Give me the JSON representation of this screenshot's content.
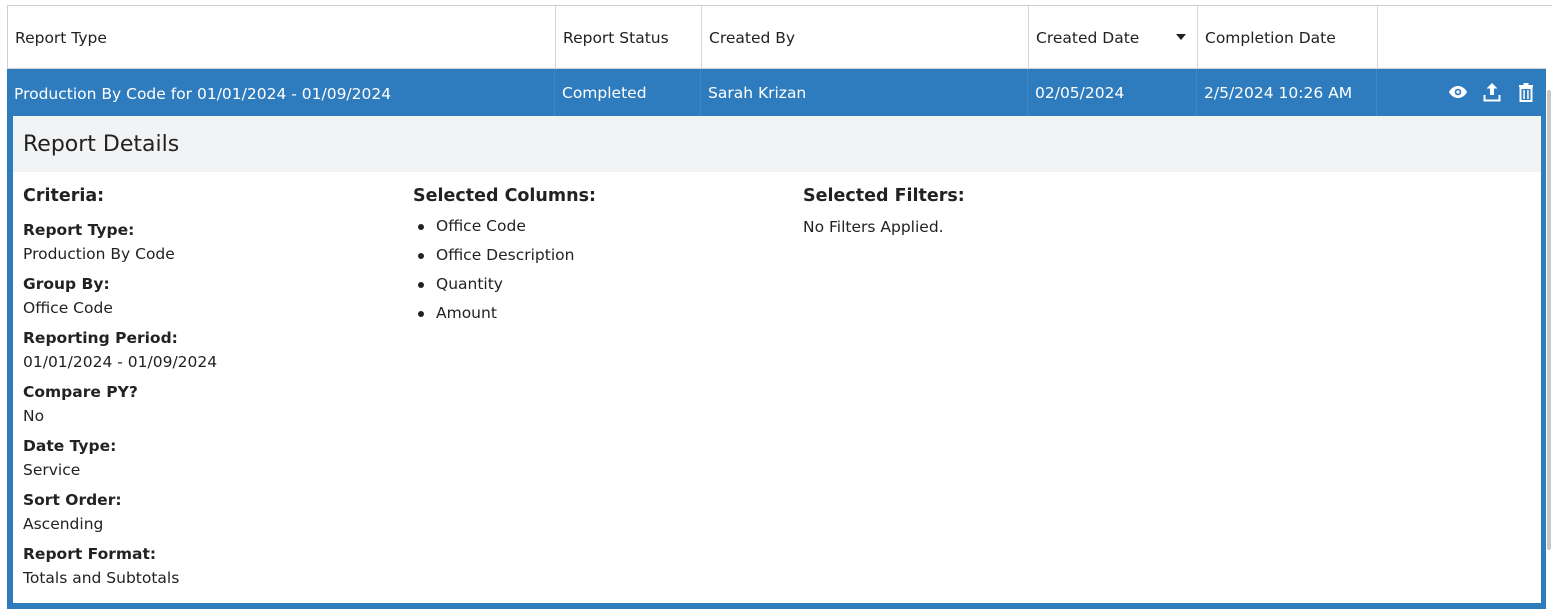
{
  "columns": {
    "report_type": "Report Type",
    "report_status": "Report Status",
    "created_by": "Created By",
    "created_date": "Created Date",
    "completion_date": "Completion Date"
  },
  "row": {
    "report_type": "Production By Code for 01/01/2024 - 01/09/2024",
    "report_status": "Completed",
    "created_by": "Sarah Krizan",
    "created_date": "02/05/2024",
    "completion_date": "2/5/2024 10:26 AM"
  },
  "actions": [
    "eye-icon",
    "upload-icon",
    "trash-icon"
  ],
  "details": {
    "title": "Report Details",
    "criteria_title": "Criteria:",
    "criteria": [
      {
        "label": "Report Type:",
        "value": "Production By Code"
      },
      {
        "label": "Group By:",
        "value": "Office Code"
      },
      {
        "label": "Reporting Period:",
        "value": "01/01/2024 - 01/09/2024"
      },
      {
        "label": "Compare PY?",
        "value": "No"
      },
      {
        "label": "Date Type:",
        "value": "Service"
      },
      {
        "label": "Sort Order:",
        "value": "Ascending"
      },
      {
        "label": "Report Format:",
        "value": "Totals and Subtotals"
      }
    ],
    "columns_title": "Selected Columns:",
    "selected_columns": [
      "Office Code",
      "Office Description",
      "Quantity",
      "Amount"
    ],
    "filters_title": "Selected Filters:",
    "filters_text": "No Filters Applied."
  },
  "colors": {
    "row_selected": "#2e7bbd",
    "details_header_bg": "#f2f3f4"
  }
}
